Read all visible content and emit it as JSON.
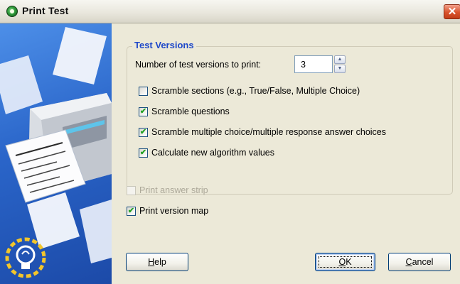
{
  "window": {
    "title": "Print Test",
    "icon": "green-ring-app-icon",
    "close_glyph": "✕"
  },
  "test_versions": {
    "group_title": "Test Versions",
    "count_label": "Number of test versions to print:",
    "count_value": "3",
    "spin_up_glyph": "▲",
    "spin_down_glyph": "▼",
    "options": [
      {
        "label": "Scramble sections (e.g., True/False, Multiple Choice)",
        "checked": false,
        "enabled": true
      },
      {
        "label": "Scramble questions",
        "checked": true,
        "enabled": true
      },
      {
        "label": "Scramble multiple choice/multiple response answer choices",
        "checked": true,
        "enabled": true
      },
      {
        "label": "Calculate new algorithm values",
        "checked": true,
        "enabled": true
      }
    ]
  },
  "print_options": [
    {
      "label": "Print answer strip",
      "checked": false,
      "enabled": false
    },
    {
      "label": "Print version map",
      "checked": true,
      "enabled": true
    }
  ],
  "buttons": {
    "help": {
      "mnemonic": "H",
      "rest": "elp"
    },
    "ok": {
      "mnemonic": "O",
      "rest": "K"
    },
    "cancel": {
      "mnemonic": "C",
      "rest": "ancel"
    }
  },
  "check_glyph": "✔",
  "colors": {
    "title_gradient_top": "#f7f6f1",
    "panel_blue": "#2a65c9",
    "group_title": "#1e48c9",
    "dialog_bg": "#ece9d8",
    "check_green": "#21a121",
    "close_red": "#d9532c"
  }
}
